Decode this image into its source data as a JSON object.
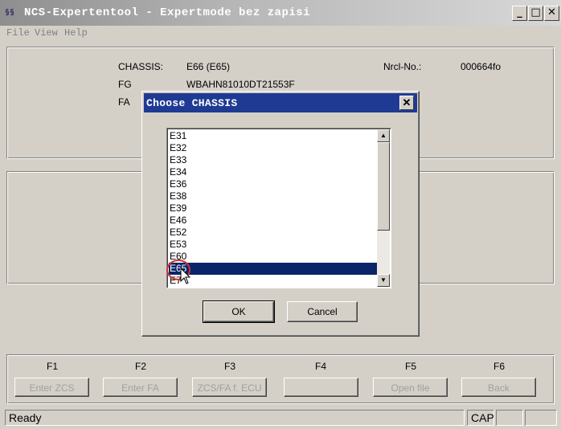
{
  "window": {
    "title": "NCS-Expertentool - Expertmode bez zapisi",
    "icon_text": "§§",
    "controls": {
      "minimize": "_",
      "maximize": "□",
      "close": "✕"
    }
  },
  "menu": [
    "File",
    "View",
    "Help"
  ],
  "info": {
    "chassis_label": "CHASSIS:",
    "chassis_value": "E66 (E65)",
    "fg_label": "FG",
    "fg_value": "WBAHN81010DT21553F",
    "fa_label": "FA",
    "nrcl_label": "Nrcl-No.:",
    "nrcl_value": "000664fo"
  },
  "function_keys": [
    {
      "key": "F1",
      "label": "Enter ZCS"
    },
    {
      "key": "F2",
      "label": "Enter FA"
    },
    {
      "key": "F3",
      "label": "ZCS/FA f. ECU"
    },
    {
      "key": "F4",
      "label": ""
    },
    {
      "key": "F5",
      "label": "Open file"
    },
    {
      "key": "F6",
      "label": "Back"
    }
  ],
  "status": {
    "text": "Ready",
    "cap": "CAP"
  },
  "dialog": {
    "title": "Choose CHASSIS",
    "close": "✕",
    "items": [
      "E31",
      "E32",
      "E33",
      "E34",
      "E36",
      "E38",
      "E39",
      "E46",
      "E52",
      "E53",
      "E60",
      "E65",
      "E7"
    ],
    "selected": "E65",
    "ok_label": "OK",
    "cancel_label": "Cancel"
  }
}
